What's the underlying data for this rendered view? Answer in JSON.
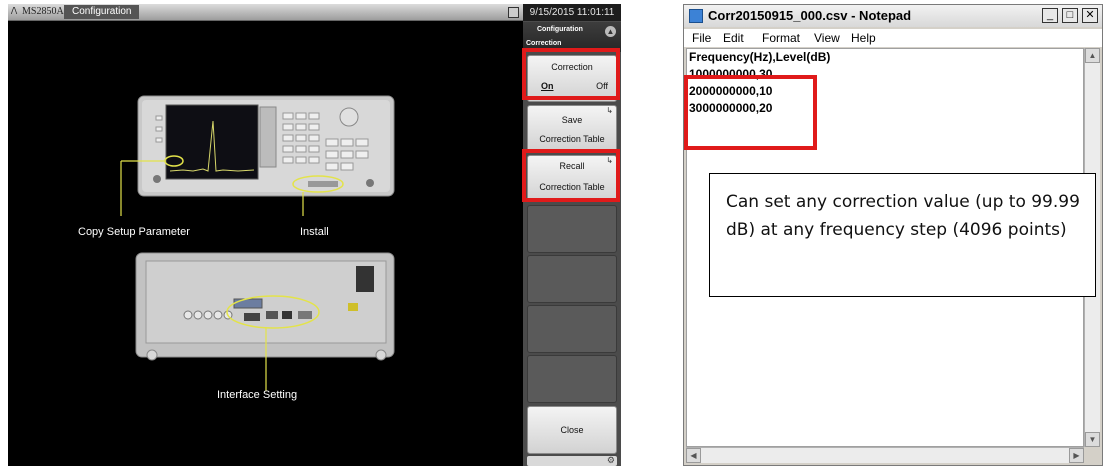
{
  "instrument": {
    "logo": "/\\",
    "model": "MS2850A",
    "title": "Configuration",
    "labels": {
      "copy_setup": "Copy Setup Parameter",
      "install": "Install",
      "interface": "Interface Setting"
    }
  },
  "panel": {
    "clock": "9/15/2015 11:01:11",
    "title": "Configuration",
    "subtitle": "Correction",
    "correction": {
      "label": "Correction",
      "on": "On",
      "off": "Off"
    },
    "save": {
      "line1": "Save",
      "line2": "Correction Table"
    },
    "recall": {
      "line1": "Recall",
      "line2": "Correction Table"
    },
    "close": "Close"
  },
  "notepad": {
    "title": "Corr20150915_000.csv - Notepad",
    "menu": [
      "File",
      "Edit",
      "Format",
      "View",
      "Help"
    ],
    "lines": [
      "Frequency(Hz),Level(dB)",
      "1000000000,30",
      "2000000000,10",
      "3000000000,20"
    ]
  },
  "note": {
    "text": "Can set any correction value (up to 99.99 dB) at any frequency step (4096 points)"
  },
  "colors": {
    "highlight": "#e01a1a",
    "ellipse": "#e3e34a"
  }
}
